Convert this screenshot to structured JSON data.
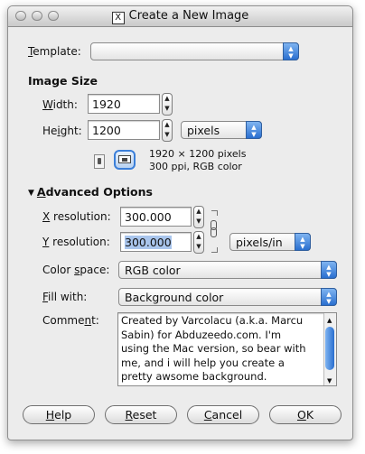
{
  "window": {
    "title": "Create a New Image"
  },
  "template": {
    "label_u": "T",
    "label_rest": "emplate:",
    "value": ""
  },
  "image_size": {
    "heading": "Image Size",
    "width_label_pre": "",
    "width_label_u": "W",
    "width_label_rest": "idth:",
    "width_value": "1920",
    "height_label_pre": "He",
    "height_label_u": "i",
    "height_label_rest": "ght:",
    "height_value": "1200",
    "unit": "pixels",
    "info_line1": "1920 × 1200 pixels",
    "info_line2": "300 ppi, RGB color"
  },
  "advanced": {
    "heading_u": "A",
    "heading_rest": "dvanced Options",
    "xres_label_u": "X",
    "xres_label_rest": " resolution:",
    "xres_value": "300.000",
    "yres_label_u": "Y",
    "yres_label_rest": " resolution:",
    "yres_value": "300.000",
    "res_unit": "pixels/in",
    "colorspace_label_pre": "Color ",
    "colorspace_label_u": "s",
    "colorspace_label_rest": "pace:",
    "colorspace_value": "RGB color",
    "fill_label_u": "F",
    "fill_label_rest": "ill with:",
    "fill_value": "Background color",
    "comment_label_pre": "Comme",
    "comment_label_u": "n",
    "comment_label_rest": "t:",
    "comment_lines": [
      "Created by Varcolacu (a.k.a. Marcu",
      "Sabin) for Abduzeedo.com. I'm",
      "using the Mac version, so bear with",
      "me, and i will help you create a",
      "pretty awsome background."
    ]
  },
  "buttons": {
    "help_u": "H",
    "help_rest": "elp",
    "reset_u": "R",
    "reset_rest": "eset",
    "cancel_u": "C",
    "cancel_rest": "ancel",
    "ok_u": "O",
    "ok_rest": "K"
  },
  "colors": {
    "selection": "#a9c5ec",
    "accent": "#3b7fd9"
  },
  "icons": [
    "close-light-icon",
    "minimize-light-icon",
    "zoom-light-icon",
    "x11-icon",
    "portrait-icon",
    "landscape-icon",
    "chain-link-icon",
    "triangle-down-icon"
  ]
}
